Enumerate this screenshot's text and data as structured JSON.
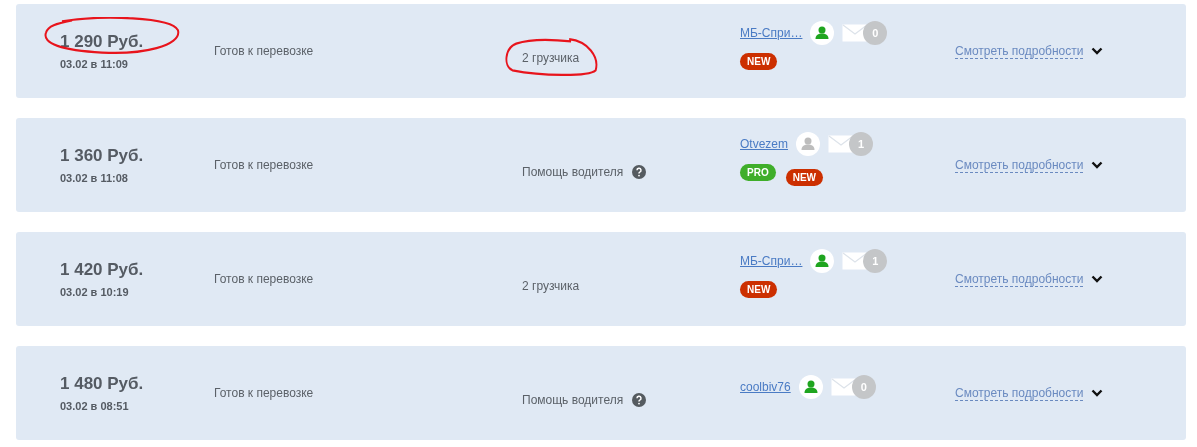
{
  "orders": [
    {
      "price": "1 290 Руб.",
      "price_circled": true,
      "date": "03.02 в 11:09",
      "status": "Готов к перевозке",
      "service": "2 грузчика",
      "service_circled": true,
      "service_help": false,
      "user": "МБ-Спри…",
      "user_online": true,
      "messages": "0",
      "badges": [
        {
          "kind": "new",
          "label": "NEW"
        }
      ],
      "details": "Смотреть подробности"
    },
    {
      "price": "1 360 Руб.",
      "price_circled": false,
      "date": "03.02 в 11:08",
      "status": "Готов к перевозке",
      "service": "Помощь водителя",
      "service_circled": false,
      "service_help": true,
      "user": "Otvezem",
      "user_online": false,
      "messages": "1",
      "badges": [
        {
          "kind": "pro",
          "label": "PRO"
        },
        {
          "kind": "new",
          "label": "NEW"
        }
      ],
      "details": "Смотреть подробности"
    },
    {
      "price": "1 420 Руб.",
      "price_circled": false,
      "date": "03.02 в 10:19",
      "status": "Готов к перевозке",
      "service": "2 грузчика",
      "service_circled": false,
      "service_help": false,
      "user": "МБ-Спри…",
      "user_online": true,
      "messages": "1",
      "badges": [
        {
          "kind": "new",
          "label": "NEW"
        }
      ],
      "details": "Смотреть подробности"
    },
    {
      "price": "1 480 Руб.",
      "price_circled": false,
      "date": "03.02 в 08:51",
      "status": "Готов к перевозке",
      "service": "Помощь водителя",
      "service_circled": false,
      "service_help": true,
      "user": "coolbiv76",
      "user_online": true,
      "messages": "0",
      "details": "Смотреть подробности"
    }
  ]
}
